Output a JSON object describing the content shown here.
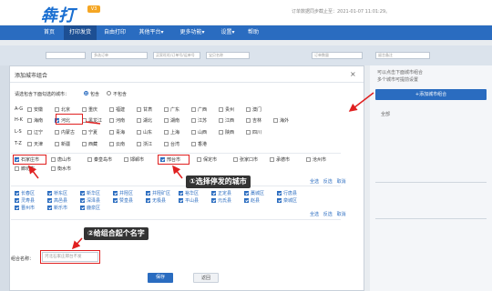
{
  "header": {
    "logo": "犇打",
    "badge": "V3",
    "info": "订单数据同步截止至：2021-01-07 11:01:29。"
  },
  "nav": {
    "items": [
      {
        "label": "首页"
      },
      {
        "label": "打印发货"
      },
      {
        "label": "自由打印"
      },
      {
        "label": "其他平台▾"
      },
      {
        "label": "更多功能▾"
      },
      {
        "label": "设置▾"
      },
      {
        "label": "帮助"
      }
    ]
  },
  "filters": {
    "f1": "",
    "f2": "多选订单",
    "f3": "买家旺旺/订单号/运单号",
    "f4": "宝贝名称",
    "f5": "订单数量",
    "f6": "留言备注"
  },
  "right_panel": {
    "top_text": "可以点击下面城市组合",
    "top_text2": "多个城市可提前设置",
    "add_button": "+添加城市组合",
    "all_label": "全部"
  },
  "modal": {
    "title": "添加城市组合",
    "close": "×",
    "include_prompt": "请选包含下面勾选的城市：",
    "include_label": "包含",
    "exclude_label": "不包含",
    "province_rows": [
      {
        "letters": "A-G",
        "items": [
          "安徽",
          "北京",
          "重庆",
          "福建",
          "甘肃",
          "广东",
          "广西",
          "贵州",
          "澳门"
        ]
      },
      {
        "letters": "H-K",
        "items": [
          "海南",
          "河北",
          "黑龙江",
          "河南",
          "湖北",
          "湖南",
          "江苏",
          "江西",
          "吉林",
          "海外"
        ]
      },
      {
        "letters": "L-S",
        "items": [
          "辽宁",
          "内蒙古",
          "宁夏",
          "青海",
          "山东",
          "上海",
          "山西",
          "陕西",
          "四川"
        ]
      },
      {
        "letters": "T-Z",
        "items": [
          "天津",
          "新疆",
          "西藏",
          "云南",
          "浙江",
          "台湾",
          "香港"
        ]
      }
    ],
    "cities_row1": [
      "石家庄市",
      "唐山市",
      "秦皇岛市",
      "邯郸市",
      "邢台市",
      "保定市",
      "张家口市",
      "承德市",
      "沧州市"
    ],
    "cities_row2": [
      "廊坊市",
      "衡水市"
    ],
    "link_all": "全选",
    "link_invert": "反选",
    "link_cancel": "取消",
    "selected_cities": [
      "长春区",
      "桥东区",
      "新华区",
      "井陉区",
      "井陉矿区",
      "裕华区",
      "正定县",
      "藁城区",
      "行唐县",
      "灵寿县",
      "高邑县",
      "深泽县",
      "赞皇县",
      "无极县",
      "平山县",
      "元氏县",
      "赵县",
      "栾城区",
      "晋州市",
      "新乐市",
      "鹿泉区"
    ],
    "name_label": "组合名称：",
    "name_placeholder": "河北石家庄邢台不发",
    "save_button": "保存",
    "back_button": "返回"
  },
  "callouts": {
    "step1": "①选择停发的城市",
    "step2": "②给组合起个名字"
  },
  "colors": {
    "accent": "#2a6cc0",
    "highlight": "#e02020"
  }
}
